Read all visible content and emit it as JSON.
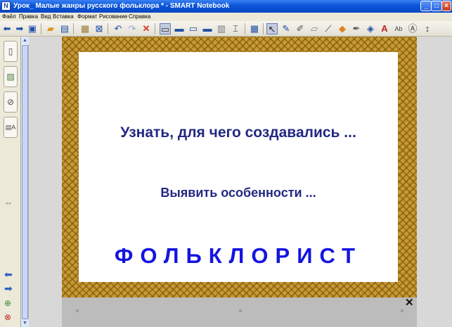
{
  "window": {
    "title": "Урок_ Малые жанры русского фольклора * - SMART Notebook",
    "buttons": {
      "minimize": "_",
      "maximize": "□",
      "close": "×"
    }
  },
  "menu": [
    "Файл",
    "Правка",
    "Вид",
    "Вставка",
    "Формат",
    "Рисование",
    "Справка"
  ],
  "toolbar": {
    "icons": [
      "back-icon",
      "forward-icon",
      "add-page-icon",
      "open-folder-icon",
      "save-icon",
      "paste-icon",
      "delete-page-icon",
      "undo-icon",
      "redo-icon",
      "delete-icon",
      "screen-shade-icon",
      "full-screen-icon",
      "dual-page-icon",
      "display-icon",
      "document-camera-icon",
      "capture-icon",
      "table-icon",
      "select-icon",
      "pen-icon",
      "creative-pen-icon",
      "eraser-icon",
      "line-icon",
      "shape-icon",
      "magic-pen-icon",
      "fill-icon",
      "text-icon",
      "text-style-icon",
      "properties-icon",
      "toolbar-move-icon"
    ]
  },
  "sidebar": {
    "tabs": [
      "page-sorter-icon",
      "gallery-icon",
      "attachments-icon",
      "properties-icon"
    ],
    "resize_glyph": "↔"
  },
  "slide": {
    "line1": "Узнать, для чего создавались ...",
    "line2": "Выявить особенности ...",
    "line3": "ФОЛЬКЛОРИСТ"
  },
  "colors": {
    "title_bar": "#0a56d8",
    "dark_text": "#232882",
    "accent_text": "#1414e0",
    "frame": "#c89a32"
  }
}
